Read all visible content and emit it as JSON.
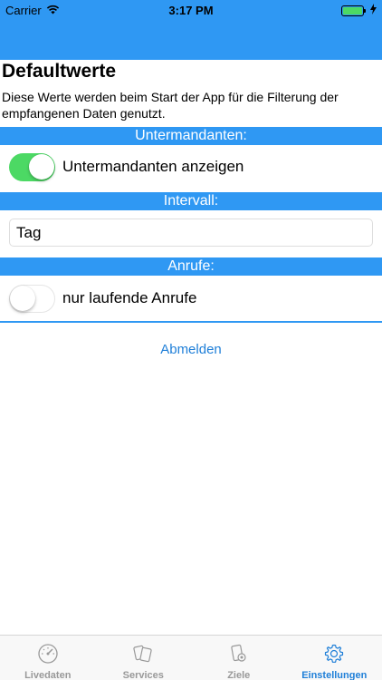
{
  "status_bar": {
    "carrier": "Carrier",
    "time": "3:17 PM"
  },
  "page": {
    "title": "Defaultwerte",
    "description": "Diese Werte werden beim Start der App für die Filterung der empfangenen Daten genutzt."
  },
  "sections": {
    "untermandanten": {
      "header": "Untermandanten:",
      "toggle_label": "Untermandanten anzeigen",
      "toggle_on": true
    },
    "intervall": {
      "header": "Intervall:",
      "value": "Tag"
    },
    "anrufe": {
      "header": "Anrufe:",
      "toggle_label": "nur laufende Anrufe",
      "toggle_on": false
    }
  },
  "logout_label": "Abmelden",
  "tabs": [
    {
      "label": "Livedaten",
      "icon": "speedometer-icon"
    },
    {
      "label": "Services",
      "icon": "phones-icon"
    },
    {
      "label": "Ziele",
      "icon": "phone-target-icon"
    },
    {
      "label": "Einstellungen",
      "icon": "gear-icon",
      "active": true
    }
  ],
  "colors": {
    "accent": "#2f98f3",
    "toggle_on": "#4cd964",
    "link": "#1f7fd8"
  }
}
